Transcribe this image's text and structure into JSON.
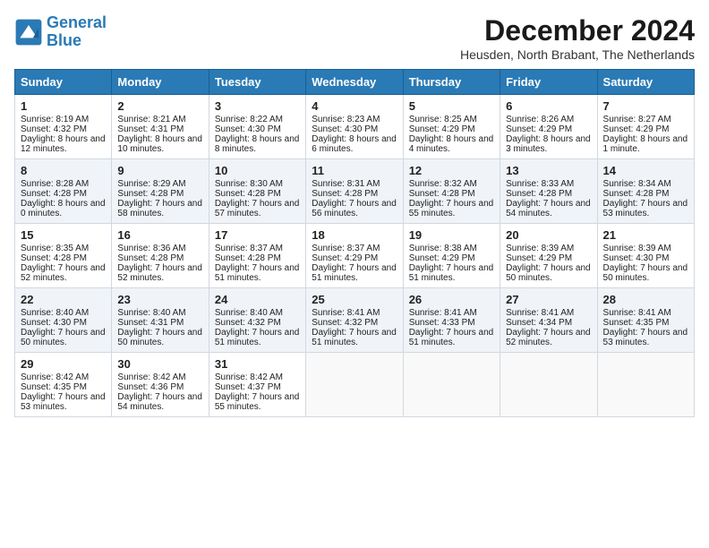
{
  "logo": {
    "line1": "General",
    "line2": "Blue"
  },
  "title": "December 2024",
  "subtitle": "Heusden, North Brabant, The Netherlands",
  "days_of_week": [
    "Sunday",
    "Monday",
    "Tuesday",
    "Wednesday",
    "Thursday",
    "Friday",
    "Saturday"
  ],
  "weeks": [
    [
      {
        "day": "1",
        "sunrise": "8:19 AM",
        "sunset": "4:32 PM",
        "daylight": "8 hours and 12 minutes."
      },
      {
        "day": "2",
        "sunrise": "8:21 AM",
        "sunset": "4:31 PM",
        "daylight": "8 hours and 10 minutes."
      },
      {
        "day": "3",
        "sunrise": "8:22 AM",
        "sunset": "4:30 PM",
        "daylight": "8 hours and 8 minutes."
      },
      {
        "day": "4",
        "sunrise": "8:23 AM",
        "sunset": "4:30 PM",
        "daylight": "8 hours and 6 minutes."
      },
      {
        "day": "5",
        "sunrise": "8:25 AM",
        "sunset": "4:29 PM",
        "daylight": "8 hours and 4 minutes."
      },
      {
        "day": "6",
        "sunrise": "8:26 AM",
        "sunset": "4:29 PM",
        "daylight": "8 hours and 3 minutes."
      },
      {
        "day": "7",
        "sunrise": "8:27 AM",
        "sunset": "4:29 PM",
        "daylight": "8 hours and 1 minute."
      }
    ],
    [
      {
        "day": "8",
        "sunrise": "8:28 AM",
        "sunset": "4:28 PM",
        "daylight": "8 hours and 0 minutes."
      },
      {
        "day": "9",
        "sunrise": "8:29 AM",
        "sunset": "4:28 PM",
        "daylight": "7 hours and 58 minutes."
      },
      {
        "day": "10",
        "sunrise": "8:30 AM",
        "sunset": "4:28 PM",
        "daylight": "7 hours and 57 minutes."
      },
      {
        "day": "11",
        "sunrise": "8:31 AM",
        "sunset": "4:28 PM",
        "daylight": "7 hours and 56 minutes."
      },
      {
        "day": "12",
        "sunrise": "8:32 AM",
        "sunset": "4:28 PM",
        "daylight": "7 hours and 55 minutes."
      },
      {
        "day": "13",
        "sunrise": "8:33 AM",
        "sunset": "4:28 PM",
        "daylight": "7 hours and 54 minutes."
      },
      {
        "day": "14",
        "sunrise": "8:34 AM",
        "sunset": "4:28 PM",
        "daylight": "7 hours and 53 minutes."
      }
    ],
    [
      {
        "day": "15",
        "sunrise": "8:35 AM",
        "sunset": "4:28 PM",
        "daylight": "7 hours and 52 minutes."
      },
      {
        "day": "16",
        "sunrise": "8:36 AM",
        "sunset": "4:28 PM",
        "daylight": "7 hours and 52 minutes."
      },
      {
        "day": "17",
        "sunrise": "8:37 AM",
        "sunset": "4:28 PM",
        "daylight": "7 hours and 51 minutes."
      },
      {
        "day": "18",
        "sunrise": "8:37 AM",
        "sunset": "4:29 PM",
        "daylight": "7 hours and 51 minutes."
      },
      {
        "day": "19",
        "sunrise": "8:38 AM",
        "sunset": "4:29 PM",
        "daylight": "7 hours and 51 minutes."
      },
      {
        "day": "20",
        "sunrise": "8:39 AM",
        "sunset": "4:29 PM",
        "daylight": "7 hours and 50 minutes."
      },
      {
        "day": "21",
        "sunrise": "8:39 AM",
        "sunset": "4:30 PM",
        "daylight": "7 hours and 50 minutes."
      }
    ],
    [
      {
        "day": "22",
        "sunrise": "8:40 AM",
        "sunset": "4:30 PM",
        "daylight": "7 hours and 50 minutes."
      },
      {
        "day": "23",
        "sunrise": "8:40 AM",
        "sunset": "4:31 PM",
        "daylight": "7 hours and 50 minutes."
      },
      {
        "day": "24",
        "sunrise": "8:40 AM",
        "sunset": "4:32 PM",
        "daylight": "7 hours and 51 minutes."
      },
      {
        "day": "25",
        "sunrise": "8:41 AM",
        "sunset": "4:32 PM",
        "daylight": "7 hours and 51 minutes."
      },
      {
        "day": "26",
        "sunrise": "8:41 AM",
        "sunset": "4:33 PM",
        "daylight": "7 hours and 51 minutes."
      },
      {
        "day": "27",
        "sunrise": "8:41 AM",
        "sunset": "4:34 PM",
        "daylight": "7 hours and 52 minutes."
      },
      {
        "day": "28",
        "sunrise": "8:41 AM",
        "sunset": "4:35 PM",
        "daylight": "7 hours and 53 minutes."
      }
    ],
    [
      {
        "day": "29",
        "sunrise": "8:42 AM",
        "sunset": "4:35 PM",
        "daylight": "7 hours and 53 minutes."
      },
      {
        "day": "30",
        "sunrise": "8:42 AM",
        "sunset": "4:36 PM",
        "daylight": "7 hours and 54 minutes."
      },
      {
        "day": "31",
        "sunrise": "8:42 AM",
        "sunset": "4:37 PM",
        "daylight": "7 hours and 55 minutes."
      },
      null,
      null,
      null,
      null
    ]
  ]
}
